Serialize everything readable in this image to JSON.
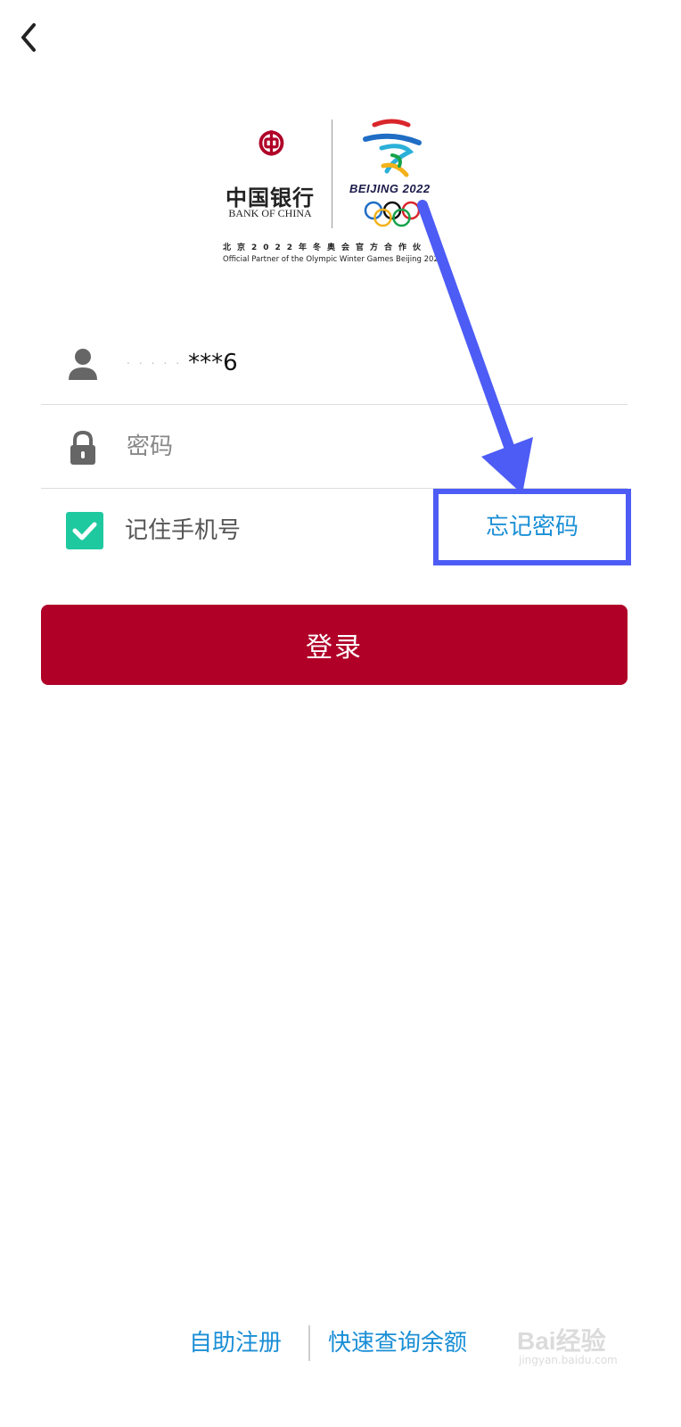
{
  "nav": {
    "back_icon": "chevron-left-icon"
  },
  "branding": {
    "bank_name_cn": "中国银行",
    "bank_name_en": "BANK OF CHINA",
    "olympic_wordmark": "BEIJING 2022",
    "partner_cn": "北京2022年冬奥会官方合作伙",
    "partner_en": "Official Partner of the Olympic Winter Games Beijing 202"
  },
  "form": {
    "username": {
      "icon": "user-icon",
      "value": "***6"
    },
    "password": {
      "icon": "lock-icon",
      "placeholder": "密码"
    },
    "remember": {
      "checked": true,
      "label": "记住手机号"
    },
    "forgot_label": "忘记密码",
    "login_label": "登录"
  },
  "footer": {
    "register_label": "自助注册",
    "balance_label": "快速查询余额"
  },
  "watermark": {
    "text": "Bai经验",
    "url": "jingyan.baidu.com"
  },
  "colors": {
    "primary": "#b00028",
    "link": "#1b8fd6",
    "checkbox": "#1ec9a0",
    "annotation": "#4d5cf5"
  }
}
